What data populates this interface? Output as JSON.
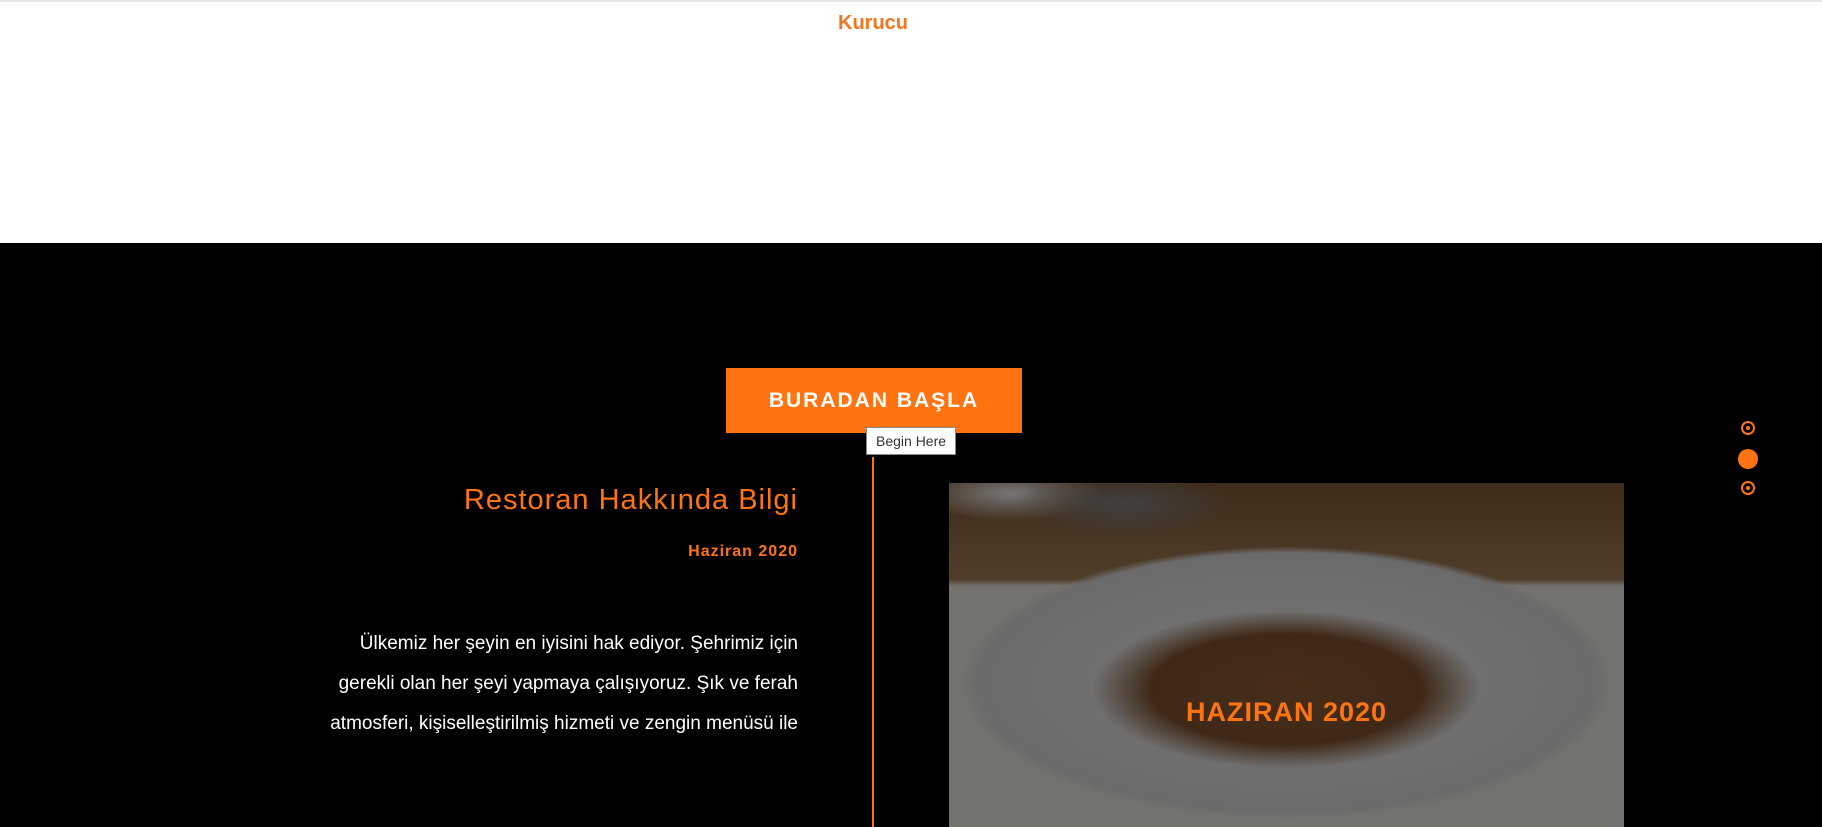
{
  "founder_section": {
    "label": "Kurucu"
  },
  "timeline": {
    "start_button_label": "BURADAN BAŞLA",
    "start_tooltip": "Begin Here",
    "entry": {
      "title": "Restoran Hakkında Bilgi",
      "date": "Haziran 2020",
      "body_lines": [
        "Ülkemiz her şeyin en iyisini hak ediyor. Şehrimiz için",
        "gerekli olan her şeyi yapmaya çalışıyoruz. Şık ve ferah",
        "atmosferi, kişiselleştirilmiş hizmeti ve zengin menüsü ile"
      ],
      "image_caption": "HAZIRAN 2020"
    }
  },
  "scroll_nav": {
    "dots": 3,
    "active_index": 1
  },
  "colors": {
    "accent": "#ff7410",
    "dark_background": "#000000",
    "light_background": "#ffffff"
  }
}
